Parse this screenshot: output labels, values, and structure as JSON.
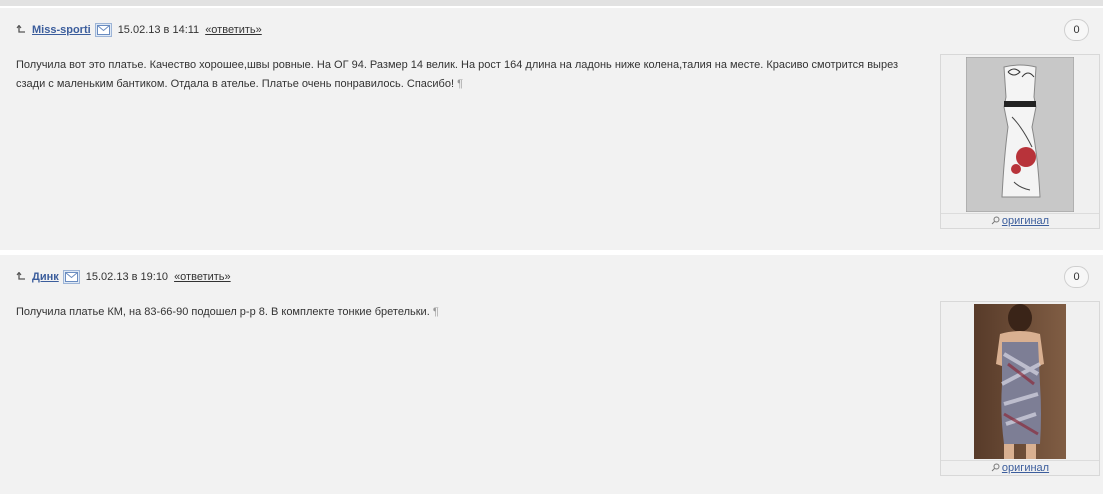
{
  "comments": [
    {
      "author": "Miss-sporti",
      "date": "15.02.13 в 14:11",
      "reply": "«ответить»",
      "count": "0",
      "text": "Получила вот это платье. Качество хорошее,швы ровные. На ОГ 94. Размер 14 велик. На рост 164 длина на ладонь ниже колена,талия на месте. Красиво смотрится вырез сзади с маленьким бантиком. Отдала в ателье. Платье очень понравилось. Спасибо!",
      "pilcrow": "¶",
      "original_label": "оригинал"
    },
    {
      "author": "Динк",
      "date": "15.02.13 в 19:10",
      "reply": "«ответить»",
      "count": "0",
      "text": "Получила платье КМ, на 83-66-90 подошел р-р 8. В комплекте тонкие бретельки.",
      "pilcrow": "¶",
      "original_label": "оригинал"
    }
  ],
  "colors": {
    "link": "#3b5d9c",
    "background": "#f2f2f2"
  }
}
